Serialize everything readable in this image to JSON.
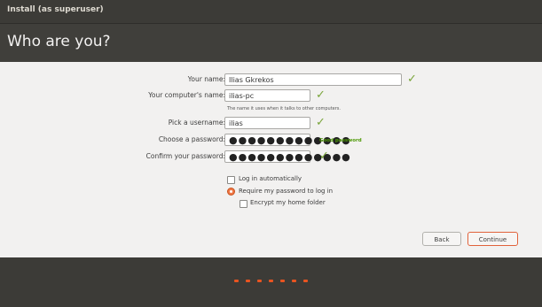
{
  "window": {
    "title": "Install (as superuser)"
  },
  "page": {
    "heading": "Who are you?"
  },
  "form": {
    "name_label": "Your name:",
    "name_value": "Ilias Gkrekos",
    "computer_label": "Your computer's name:",
    "computer_value": "ilias-pc",
    "computer_hint": "The name it uses when it talks to other computers.",
    "username_label": "Pick a username:",
    "username_value": "ilias",
    "password_label": "Choose a password:",
    "password_value": "●●●●●●●●●●●●●",
    "password_strength": "Good password",
    "confirm_label": "Confirm your password:",
    "confirm_value": "●●●●●●●●●●●●●",
    "login_auto": "Log in automatically",
    "require_password": "Require my password to log in",
    "encrypt_home": "Encrypt my home folder"
  },
  "buttons": {
    "back": "Back",
    "continue": "Continue"
  },
  "progress": {
    "total_steps": 7
  },
  "colors": {
    "accent": "#e95420",
    "check": "#7aa53b",
    "background": "#f2f1f0",
    "header": "#3c3b37"
  }
}
